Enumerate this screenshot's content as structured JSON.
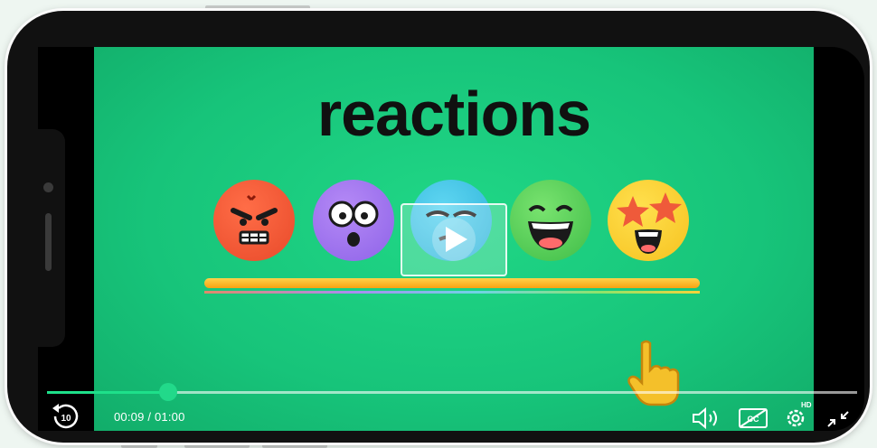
{
  "video": {
    "title_text": "reactions",
    "current_time": "00:09",
    "duration": "01:00",
    "time_display": "00:09 / 01:00",
    "progress": 0.15,
    "quality_badge": "HD",
    "replay_seconds": "10"
  },
  "controls": {
    "replay": "replay-10-icon",
    "volume": "volume-icon",
    "captions": "captions-off-icon",
    "settings": "gear-icon",
    "fullscreen": "exit-fullscreen-icon",
    "play": "play-icon"
  },
  "colors": {
    "accent": "#22d98a",
    "video_background": "#17c47a",
    "bar": "#f7a313"
  }
}
